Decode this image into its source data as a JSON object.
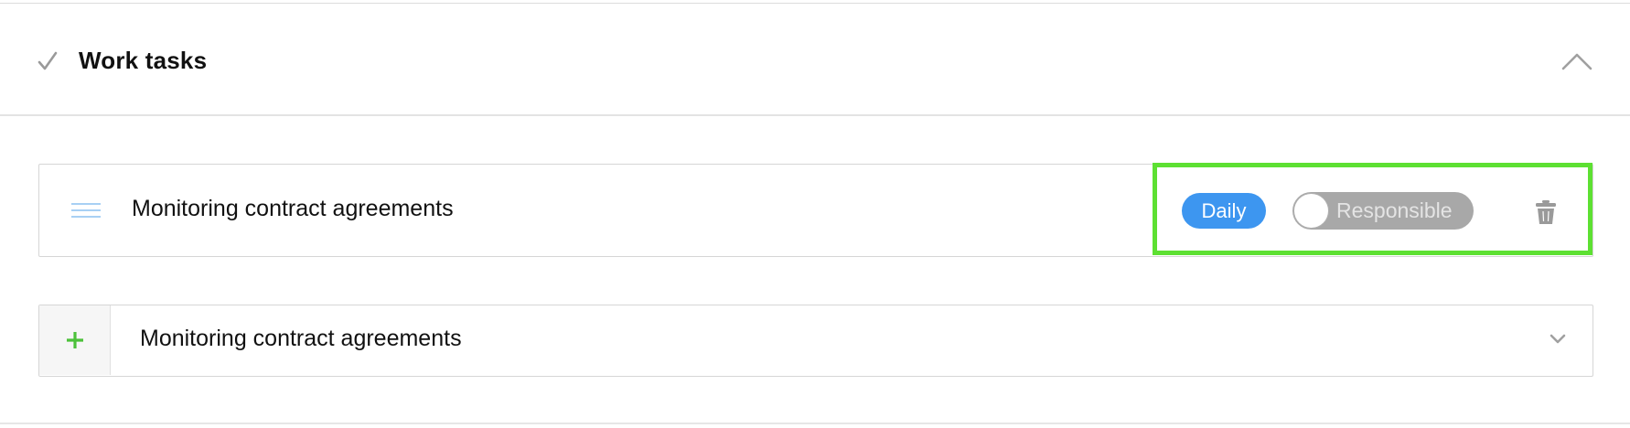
{
  "section": {
    "title": "Work tasks",
    "status_icon": "check-icon",
    "collapse_icon": "chevron-up-icon"
  },
  "task": {
    "label": "Monitoring contract agreements",
    "frequency": "Daily",
    "responsible_toggle": {
      "label": "Responsible",
      "on": false
    },
    "drag_icon": "drag-handle-icon",
    "delete_icon": "trash-icon"
  },
  "add_task": {
    "add_icon": "plus-icon",
    "selected_value": "Monitoring contract agreements",
    "dropdown_icon": "chevron-down-icon"
  },
  "colors": {
    "accent_blue": "#3d96f0",
    "add_green": "#4cc13b",
    "highlight_green": "#5de032",
    "toggle_off_gray": "#a8a8a8"
  }
}
